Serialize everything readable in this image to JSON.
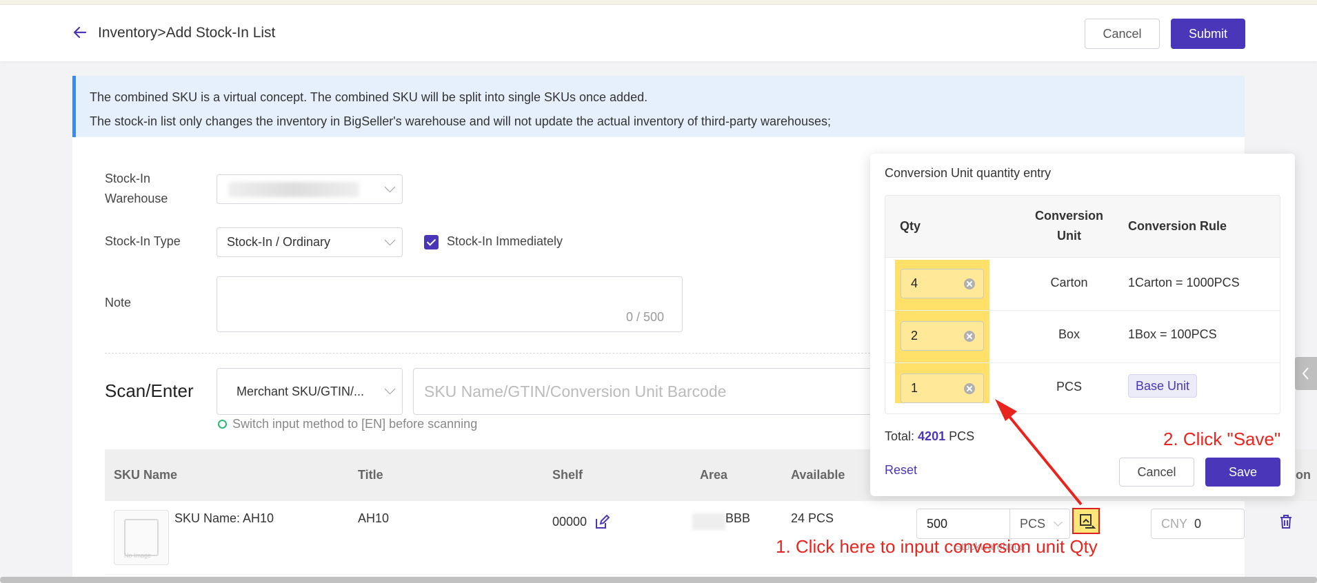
{
  "header": {
    "title": "Inventory>Add Stock-In List",
    "cancel_label": "Cancel",
    "submit_label": "Submit"
  },
  "alert": {
    "line1": "The combined SKU is a virtual concept. The combined SKU will be split into single SKUs once added.",
    "line2": "The stock-in list only changes the inventory in BigSeller's warehouse and will not update the actual inventory of third-party warehouses;"
  },
  "form": {
    "warehouse_label_1": "Stock-In",
    "warehouse_label_2": "Warehouse",
    "type_label": "Stock-In Type",
    "type_value": "Stock-In / Ordinary",
    "immediately_label": "Stock-In Immediately",
    "note_label": "Note",
    "note_count": "0 / 500"
  },
  "scan": {
    "title": "Scan/Enter",
    "mode_value": "Merchant SKU/GTIN/...",
    "placeholder": "SKU Name/GTIN/Conversion Unit Barcode",
    "hint": "Switch input method to [EN] before scanning"
  },
  "table": {
    "columns": [
      "SKU Name",
      "Title",
      "Shelf",
      "Area",
      "Available",
      "ion"
    ],
    "row": {
      "sku_name": "SKU Name: AH10",
      "title": "AH10",
      "shelf": "00000",
      "area": "BBB",
      "available": "24 PCS",
      "qty": "500",
      "unit": "PCS",
      "currency": "CNY",
      "price": "0",
      "ghost": "Stockwarehous",
      "no_image": "No Image"
    }
  },
  "popover": {
    "title": "Conversion Unit quantity entry",
    "col_qty": "Qty",
    "col_unit_1": "Conversion",
    "col_unit_2": "Unit",
    "col_rule": "Conversion Rule",
    "rows": [
      {
        "qty": "4",
        "unit": "Carton",
        "rule": "1Carton = 1000PCS"
      },
      {
        "qty": "2",
        "unit": "Box",
        "rule": "1Box = 100PCS"
      },
      {
        "qty": "1",
        "unit": "PCS",
        "rule": "Base Unit"
      }
    ],
    "total_label": "Total:",
    "total_value": "4201",
    "total_unit": "PCS",
    "reset_label": "Reset",
    "cancel_label": "Cancel",
    "save_label": "Save"
  },
  "annotations": {
    "step1": "1. Click here to input conversion unit Qty",
    "step2": "2. Click \"Save\""
  },
  "colors": {
    "accent": "#4a36b8",
    "annotation": "#e8241e",
    "highlight": "#ffe16a"
  }
}
